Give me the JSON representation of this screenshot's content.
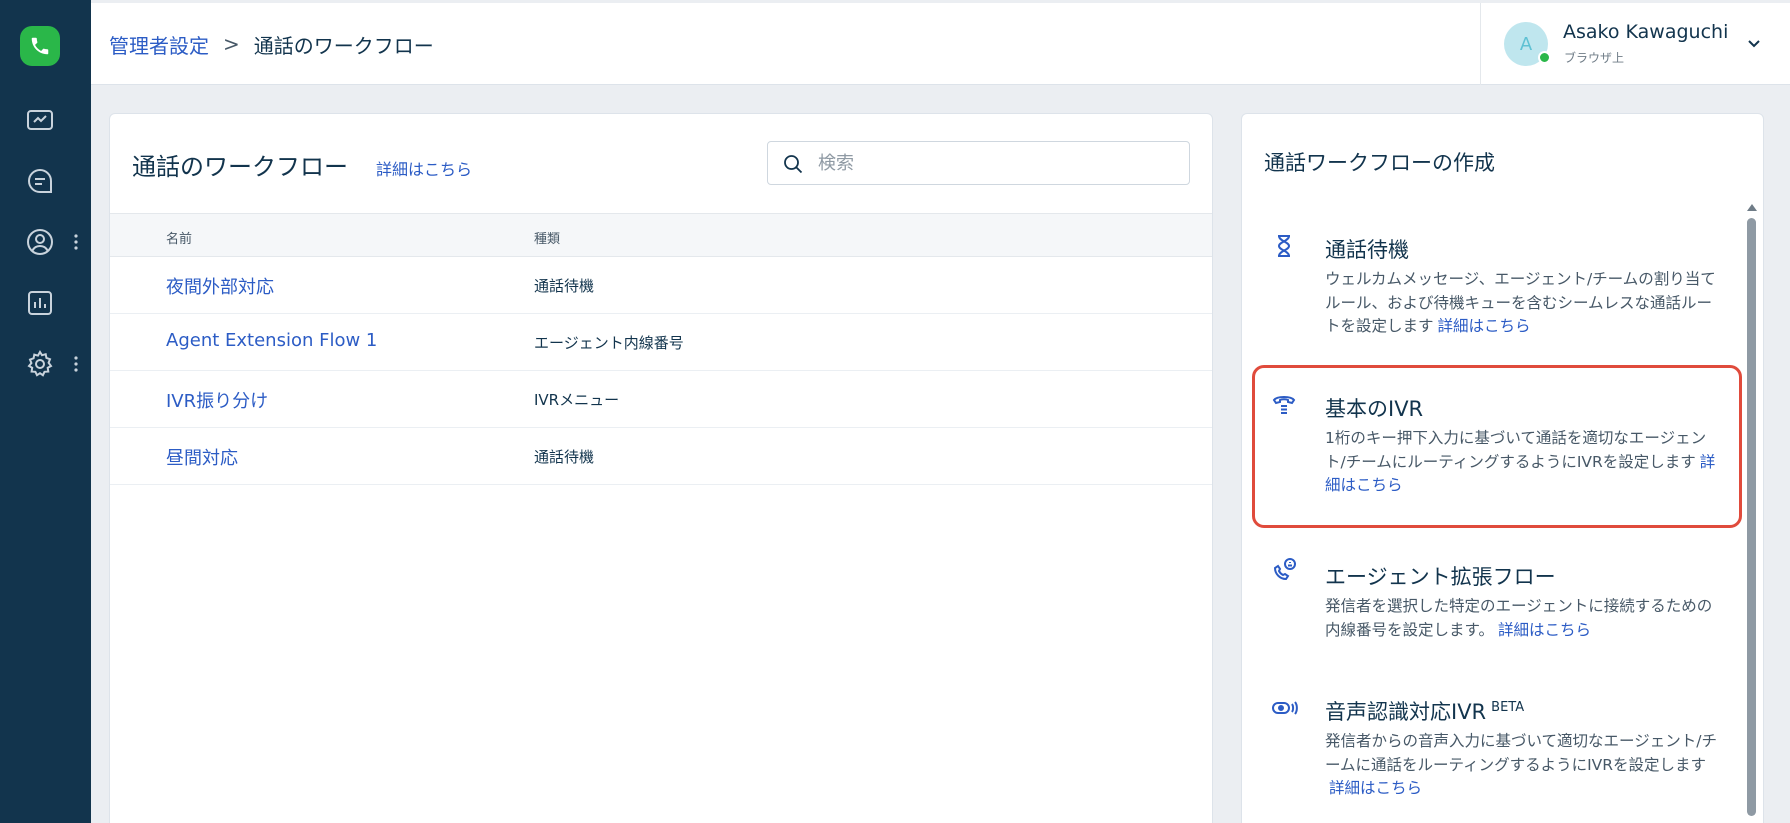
{
  "header": {
    "breadcrumb_parent": "管理者設定",
    "breadcrumb_separator": ">",
    "breadcrumb_current": "通話のワークフロー"
  },
  "user": {
    "initial": "A",
    "name": "Asako Kawaguchi",
    "status": "ブラウザ上"
  },
  "workflows": {
    "title": "通話のワークフロー",
    "learn_more": "詳細はこちら",
    "search_placeholder": "検索",
    "columns": {
      "name": "名前",
      "type": "種類"
    },
    "rows": [
      {
        "name": "夜間外部対応",
        "type": "通話待機"
      },
      {
        "name": "Agent Extension Flow 1",
        "type": "エージェント内線番号"
      },
      {
        "name": "IVR振り分け",
        "type": "IVRメニュー"
      },
      {
        "name": "昼間対応",
        "type": "通話待機"
      }
    ]
  },
  "create": {
    "title": "通話ワークフローの作成",
    "options": [
      {
        "title": "通話待機",
        "desc": "ウェルカムメッセージ、エージェント/チームの割り当てルール、および待機キューを含むシームレスな通話ルートを設定します",
        "link": "詳細はこちら",
        "icon": "hourglass-icon"
      },
      {
        "title": "基本のIVR",
        "desc": "1桁のキー押下入力に基づいて通話を適切なエージェント/チームにルーティングするようにIVRを設定します",
        "link": "詳細はこちら",
        "icon": "ivr-phone-icon"
      },
      {
        "title": "エージェント拡張フロー",
        "desc": "発信者を選択した特定のエージェントに接続するための内線番号を設定します。",
        "link": "詳細はこちら",
        "icon": "agent-extension-icon"
      },
      {
        "title": "音声認識対応IVR",
        "badge": "BETA",
        "desc": "発信者からの音声入力に基づいて適切なエージェント/チームに通話をルーティングするようにIVRを設定します",
        "link": "詳細はこちら",
        "icon": "speech-ivr-icon"
      }
    ]
  },
  "colors": {
    "sidebar": "#12344d",
    "accent": "#2c5cc5",
    "logo": "#2ab749",
    "selected_border": "#e04b3c"
  }
}
